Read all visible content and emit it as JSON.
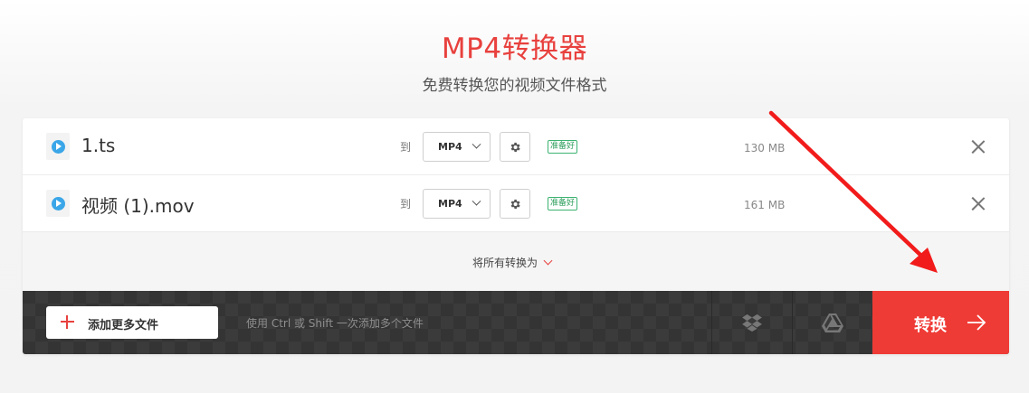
{
  "header": {
    "title": "MP4转换器",
    "subtitle": "免费转换您的视频文件格式"
  },
  "files": [
    {
      "name": "1.ts",
      "to_label": "到",
      "format": "MP4",
      "status": "准备好",
      "size": "130 MB"
    },
    {
      "name": "视频 (1).mov",
      "to_label": "到",
      "format": "MP4",
      "status": "准备好",
      "size": "161 MB"
    }
  ],
  "convert_all": {
    "label": "将所有转换为"
  },
  "actions": {
    "add_files_label": "添加更多文件",
    "hint": "使用 Ctrl 或 Shift 一次添加多个文件",
    "convert_label": "转换"
  },
  "colors": {
    "brand_red": "#ef3b36",
    "title_red": "#e8413e",
    "status_green": "#3cb371",
    "play_blue": "#3ba6e8",
    "dark_bar": "#343434"
  },
  "icons": [
    "play-icon",
    "gear-icon",
    "close-icon",
    "chevron-down-icon",
    "plus-icon",
    "dropbox-icon",
    "google-drive-icon",
    "arrow-right-icon"
  ]
}
